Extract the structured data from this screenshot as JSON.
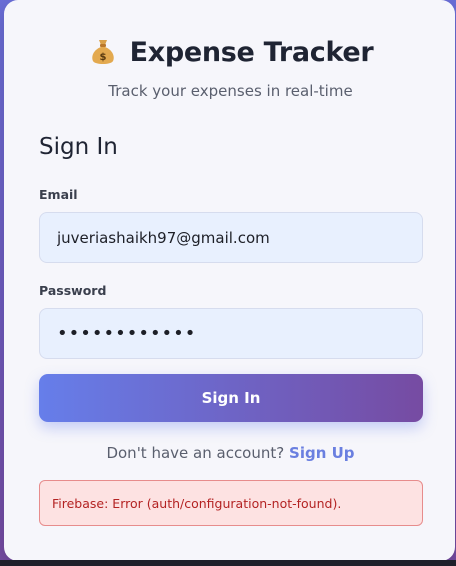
{
  "app": {
    "icon": "money-bag-icon",
    "title": "Expense Tracker",
    "subtitle": "Track your expenses in real-time"
  },
  "form": {
    "heading": "Sign In",
    "email_label": "Email",
    "email_value": "juveriashaikh97@gmail.com",
    "password_label": "Password",
    "password_value": "••••••••••••",
    "submit_label": "Sign In"
  },
  "switch": {
    "prompt": "Don't have an account?",
    "link_label": "Sign Up"
  },
  "error": {
    "message": "Firebase: Error (auth/configuration-not-found)."
  },
  "colors": {
    "accent_start": "#667eea",
    "accent_end": "#764ba2",
    "error_bg": "#fde2e2",
    "error_text": "#b42323"
  }
}
